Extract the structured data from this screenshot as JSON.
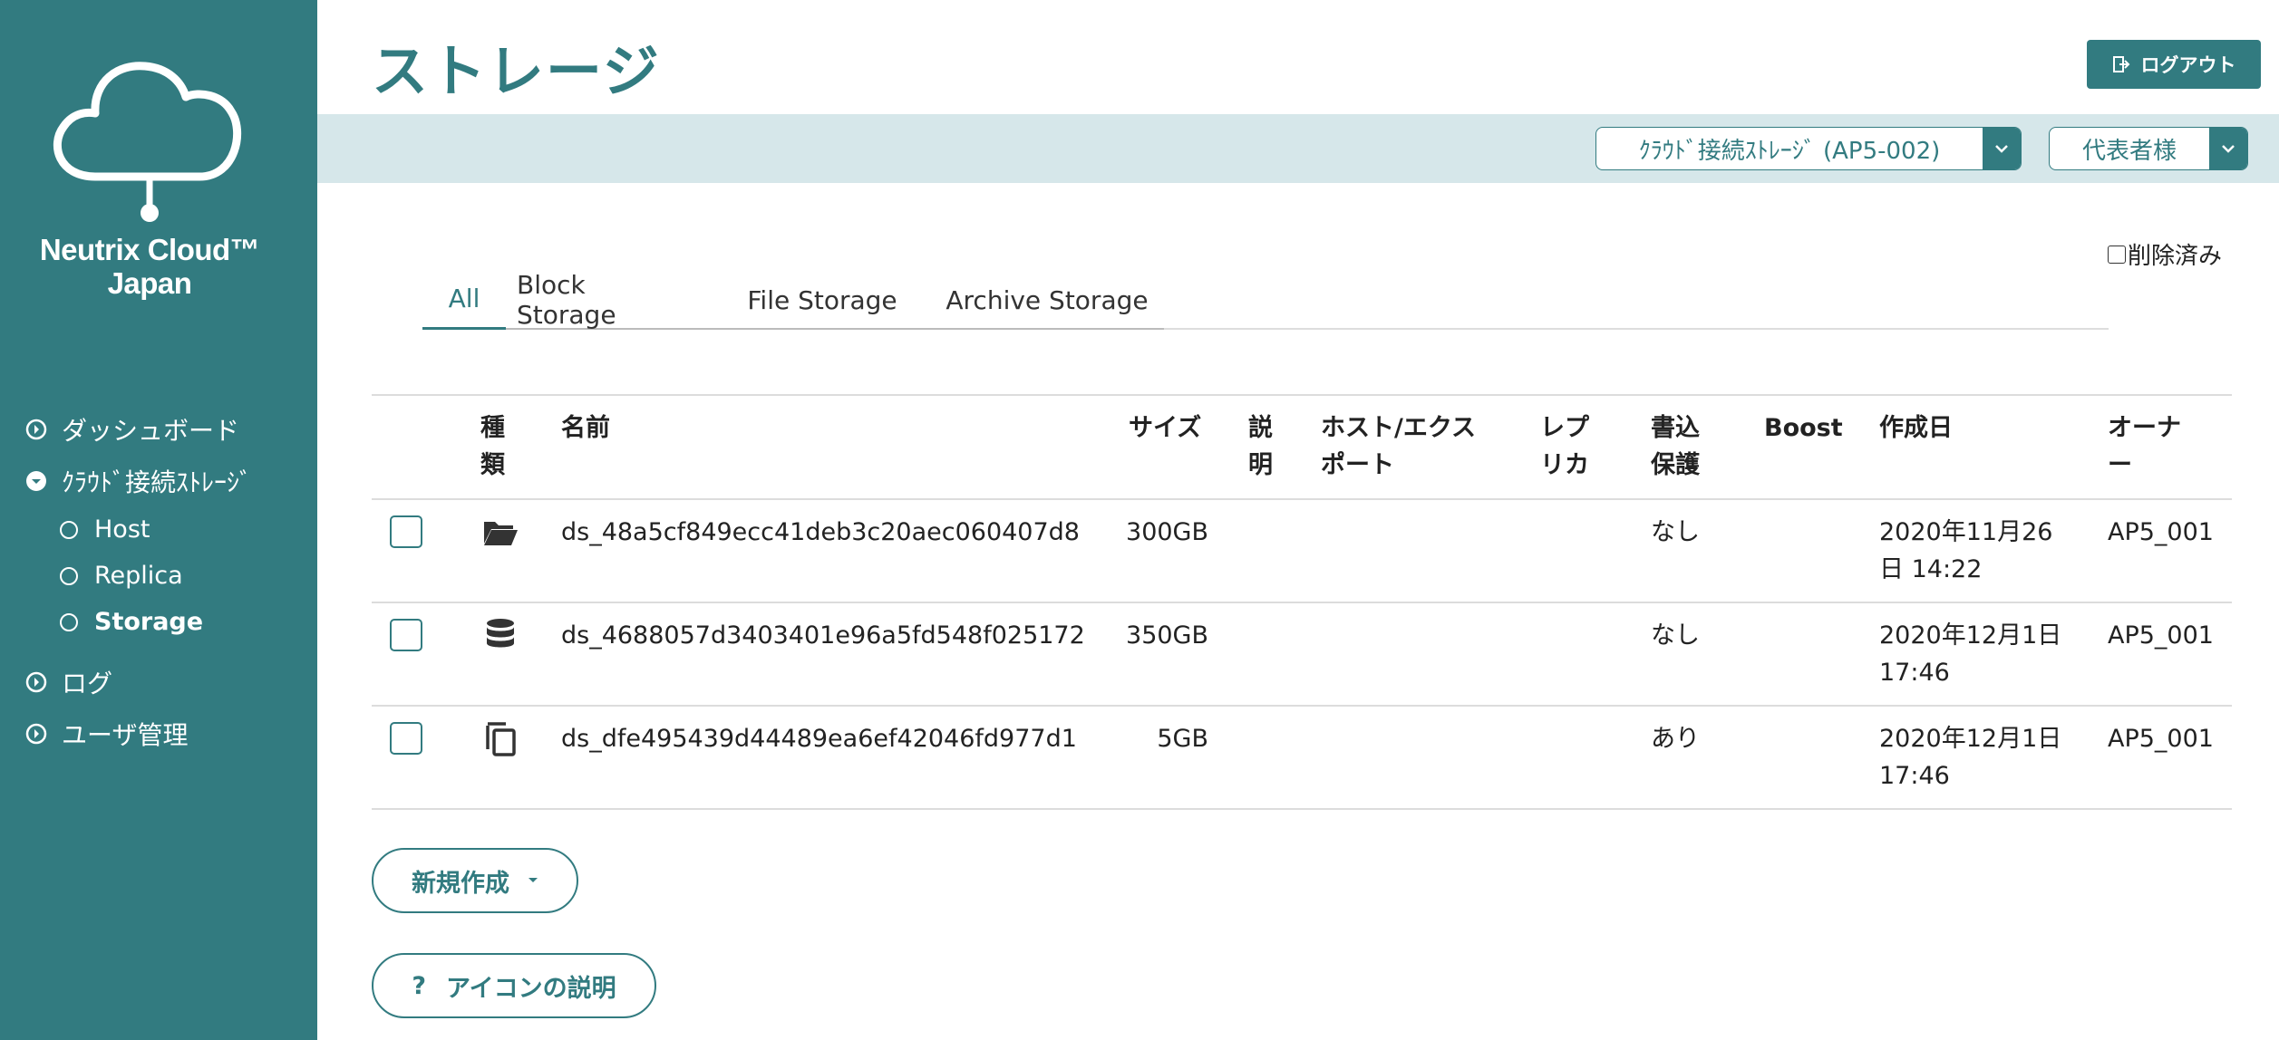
{
  "brand": {
    "line1": "Neutrix Cloud™",
    "line2": "Japan"
  },
  "sidebar": {
    "items": [
      {
        "label": "ダッシュボード",
        "icon": "chevron-right-circle-icon"
      },
      {
        "label": "ｸﾗｳﾄﾞ接続ｽﾄﾚｰｼﾞ",
        "icon": "chevron-down-circle-icon"
      },
      {
        "label": "ログ",
        "icon": "chevron-right-circle-icon"
      },
      {
        "label": "ユーザ管理",
        "icon": "chevron-right-circle-icon"
      }
    ],
    "subitems": [
      {
        "label": "Host"
      },
      {
        "label": "Replica"
      },
      {
        "label": "Storage",
        "active": true
      }
    ]
  },
  "header": {
    "title": "ストレージ",
    "logout_label": "ログアウト"
  },
  "toolbar": {
    "storage_select": "ｸﾗｳﾄﾞ接続ｽﾄﾚｰｼﾞ (AP5-002)",
    "user_select": "代表者様"
  },
  "deleted_label": "削除済み",
  "tabs": [
    "All",
    "Block Storage",
    "File Storage",
    "Archive Storage"
  ],
  "table": {
    "headers": {
      "type": [
        "種",
        "類"
      ],
      "name": "名前",
      "size": "サイズ",
      "desc": [
        "説",
        "明"
      ],
      "host": [
        "ホスト/エクス",
        "ポート"
      ],
      "replica": [
        "レプ",
        "リカ"
      ],
      "protect": [
        "書込",
        "保護"
      ],
      "boost": "Boost",
      "created": "作成日",
      "owner": [
        "オーナ",
        "ー"
      ]
    },
    "rows": [
      {
        "icon": "folder-open-icon",
        "name": "ds_48a5cf849ecc41deb3c20aec060407d8",
        "size": "300GB",
        "protect": "なし",
        "created": [
          "2020年11月26",
          "日 14:22"
        ],
        "owner": "AP5_001"
      },
      {
        "icon": "database-icon",
        "name": "ds_4688057d3403401e96a5fd548f025172",
        "size": "350GB",
        "protect": "なし",
        "created": [
          "2020年12月1日",
          "17:46"
        ],
        "owner": "AP5_001"
      },
      {
        "icon": "copy-icon",
        "name": "ds_dfe495439d44489ea6ef42046fd977d1",
        "size": "5GB",
        "protect": "あり",
        "created": [
          "2020年12月1日",
          "17:46"
        ],
        "owner": "AP5_001"
      }
    ]
  },
  "buttons": {
    "new_label": "新規作成",
    "help_prefix": "?",
    "help_label": "アイコンの説明"
  },
  "colors": {
    "accent": "#327b80",
    "toolbar_bg": "#d6e7ea"
  }
}
